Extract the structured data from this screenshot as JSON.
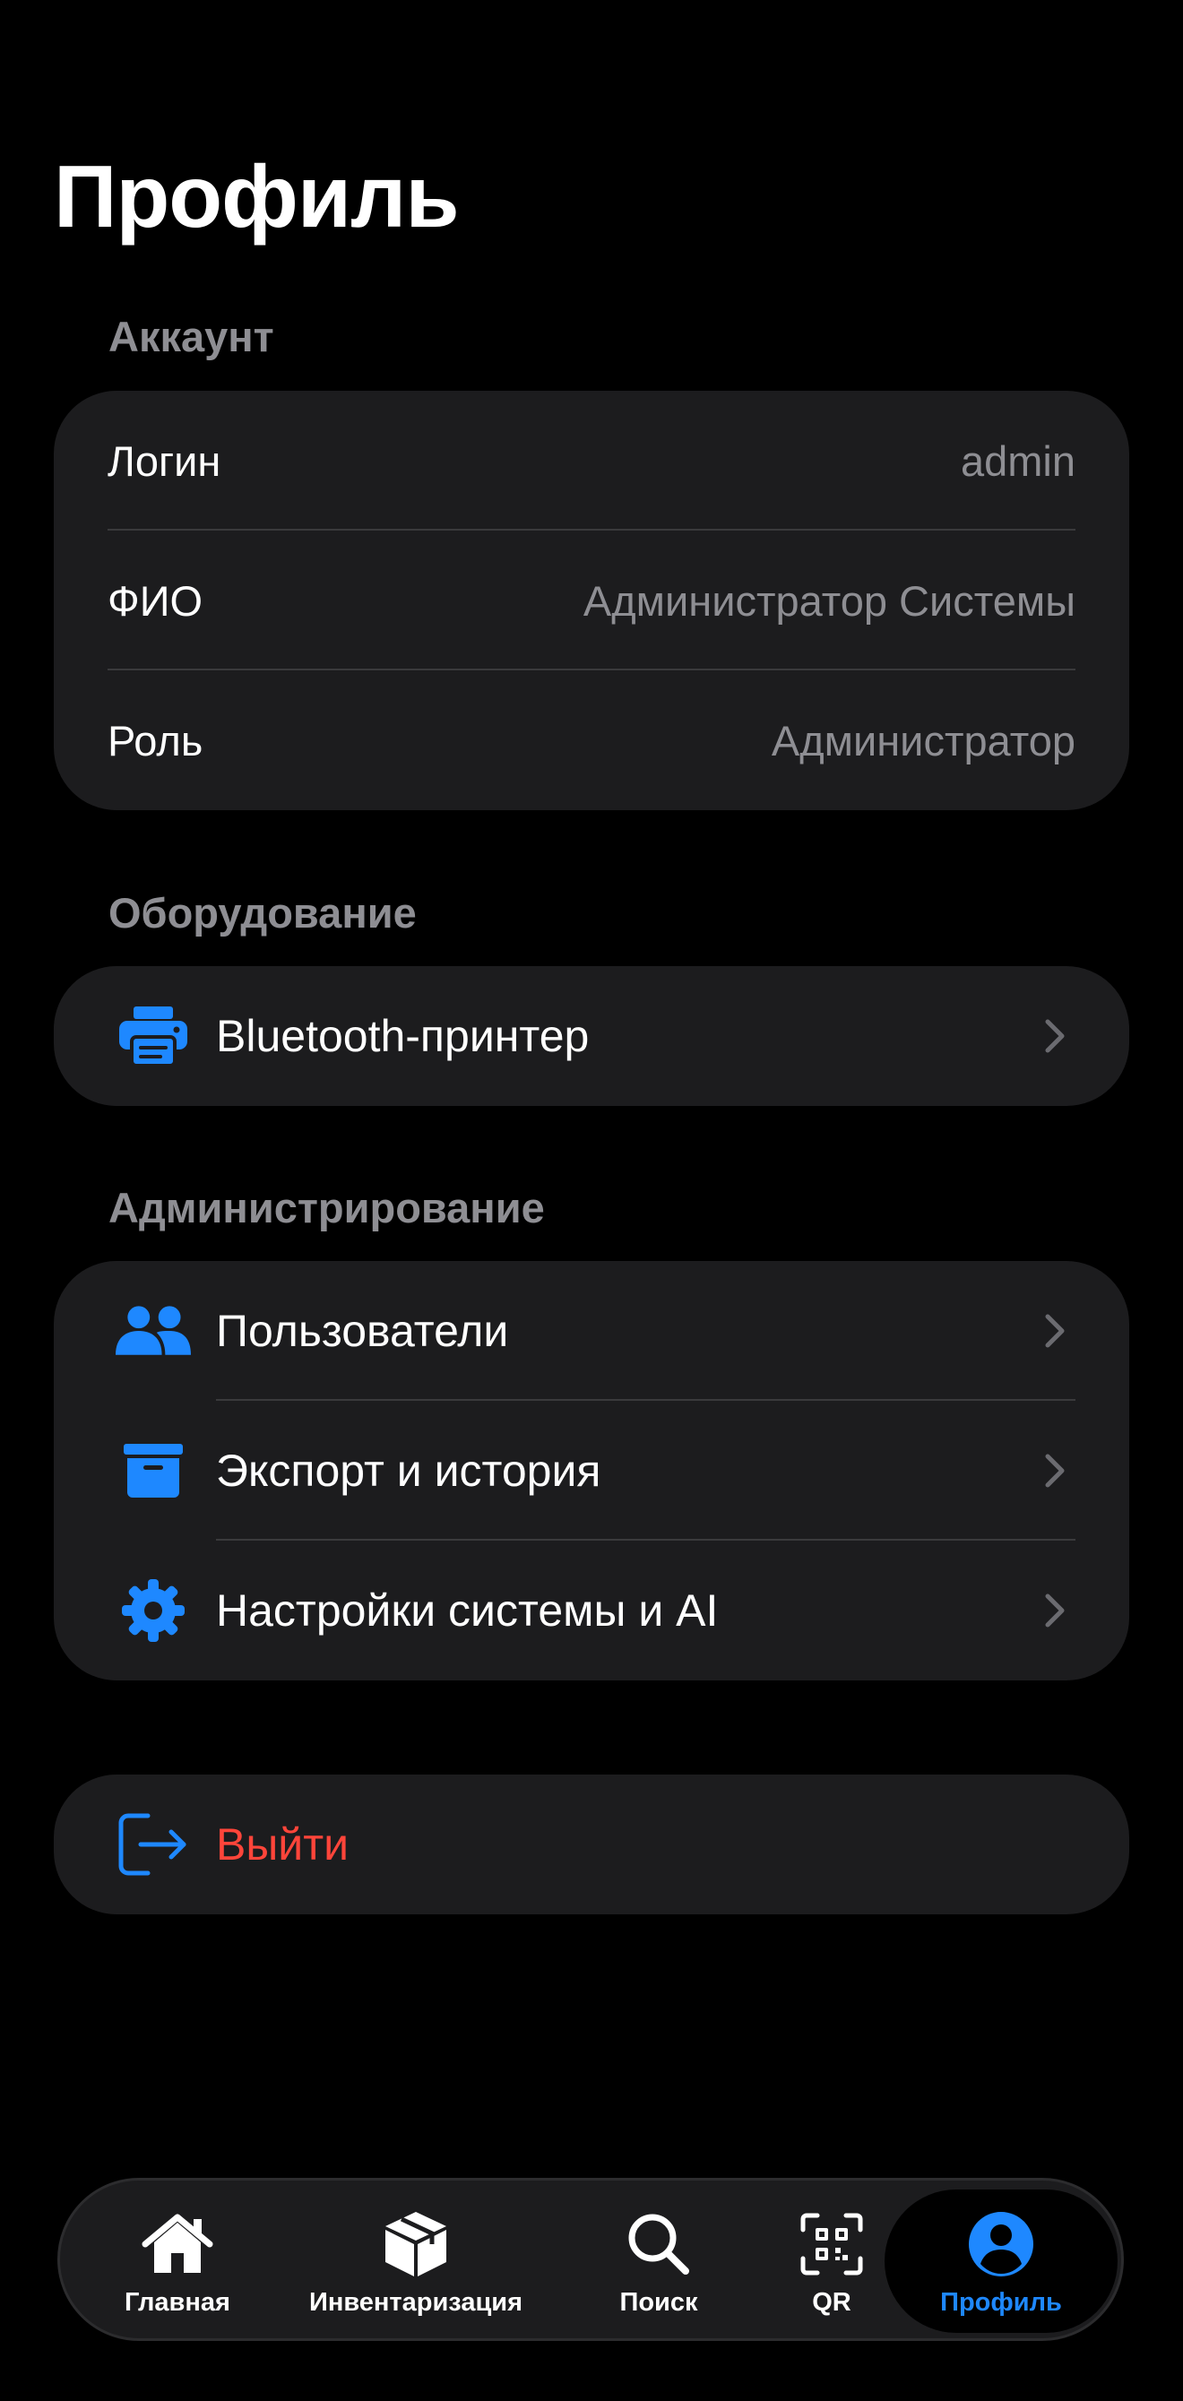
{
  "page": {
    "title": "Профиль"
  },
  "account": {
    "section_label": "Аккаунт",
    "rows": [
      {
        "key": "Логин",
        "value": "admin"
      },
      {
        "key": "ФИО",
        "value": "Администратор Системы"
      },
      {
        "key": "Роль",
        "value": "Администратор"
      }
    ]
  },
  "equipment": {
    "section_label": "Оборудование",
    "items": [
      {
        "label": "Bluetooth-принтер",
        "icon": "printer-icon"
      }
    ]
  },
  "admin": {
    "section_label": "Администрирование",
    "items": [
      {
        "label": "Пользователи",
        "icon": "users-icon"
      },
      {
        "label": "Экспорт и история",
        "icon": "archive-box-icon"
      },
      {
        "label": "Настройки системы и AI",
        "icon": "gear-icon"
      }
    ]
  },
  "logout": {
    "label": "Выйти",
    "icon": "logout-icon"
  },
  "tabbar": {
    "tabs": [
      {
        "label": "Главная",
        "icon": "home-icon"
      },
      {
        "label": "Инвентаризация",
        "icon": "cube-icon"
      },
      {
        "label": "Поиск",
        "icon": "search-icon"
      },
      {
        "label": "QR",
        "icon": "qr-scan-icon"
      },
      {
        "label": "Профиль",
        "icon": "profile-icon",
        "active": true
      }
    ]
  },
  "colors": {
    "accent": "#1e88ff",
    "danger": "#ff453a",
    "card": "#1c1c1e",
    "secondary_text": "#8e8e93"
  }
}
